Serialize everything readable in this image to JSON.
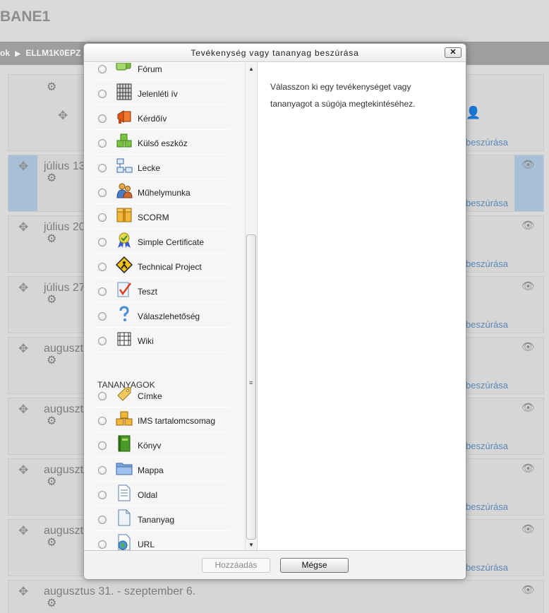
{
  "background": {
    "title": "BANE1",
    "breadcrumb": {
      "prefix": "ok",
      "separator": "▶",
      "course": "ELLM1K0EPZ"
    },
    "insert_link": "beszúrása",
    "sections": [
      {
        "label": ""
      },
      {
        "label": "július 13"
      },
      {
        "label": "július 20"
      },
      {
        "label": "július 27"
      },
      {
        "label": "augusztu"
      },
      {
        "label": "augusztu"
      },
      {
        "label": "augusztu"
      },
      {
        "label": "augusztu"
      },
      {
        "label": "augusztus 31. - szeptember 6."
      }
    ]
  },
  "dialog": {
    "title": "Tevékenység vagy tananyag beszúrása",
    "close": "✕",
    "resources_heading": "TANANYAGOK",
    "help_text": "Válasszon ki egy tevékenységet vagy tananyagot a súgója megtekintéséhez.",
    "add_button": "Hozzáadás",
    "cancel_button": "Mégse",
    "activities": [
      {
        "label": "Fórum",
        "icon": "forum-icon"
      },
      {
        "label": "Jelenléti ív",
        "icon": "attendance-icon"
      },
      {
        "label": "Kérdőív",
        "icon": "feedback-icon"
      },
      {
        "label": "Külső eszköz",
        "icon": "external-tool-icon"
      },
      {
        "label": "Lecke",
        "icon": "lesson-icon"
      },
      {
        "label": "Műhelymunka",
        "icon": "workshop-icon"
      },
      {
        "label": "SCORM",
        "icon": "scorm-icon"
      },
      {
        "label": "Simple Certificate",
        "icon": "certificate-icon"
      },
      {
        "label": "Technical Project",
        "icon": "technical-project-icon"
      },
      {
        "label": "Teszt",
        "icon": "quiz-icon"
      },
      {
        "label": "Válaszlehetőség",
        "icon": "choice-icon"
      },
      {
        "label": "Wiki",
        "icon": "wiki-icon"
      }
    ],
    "resources": [
      {
        "label": "Címke",
        "icon": "label-icon"
      },
      {
        "label": "IMS tartalomcsomag",
        "icon": "ims-package-icon"
      },
      {
        "label": "Könyv",
        "icon": "book-icon"
      },
      {
        "label": "Mappa",
        "icon": "folder-icon"
      },
      {
        "label": "Oldal",
        "icon": "page-icon"
      },
      {
        "label": "Tananyag",
        "icon": "file-icon"
      },
      {
        "label": "URL",
        "icon": "url-icon"
      }
    ]
  }
}
